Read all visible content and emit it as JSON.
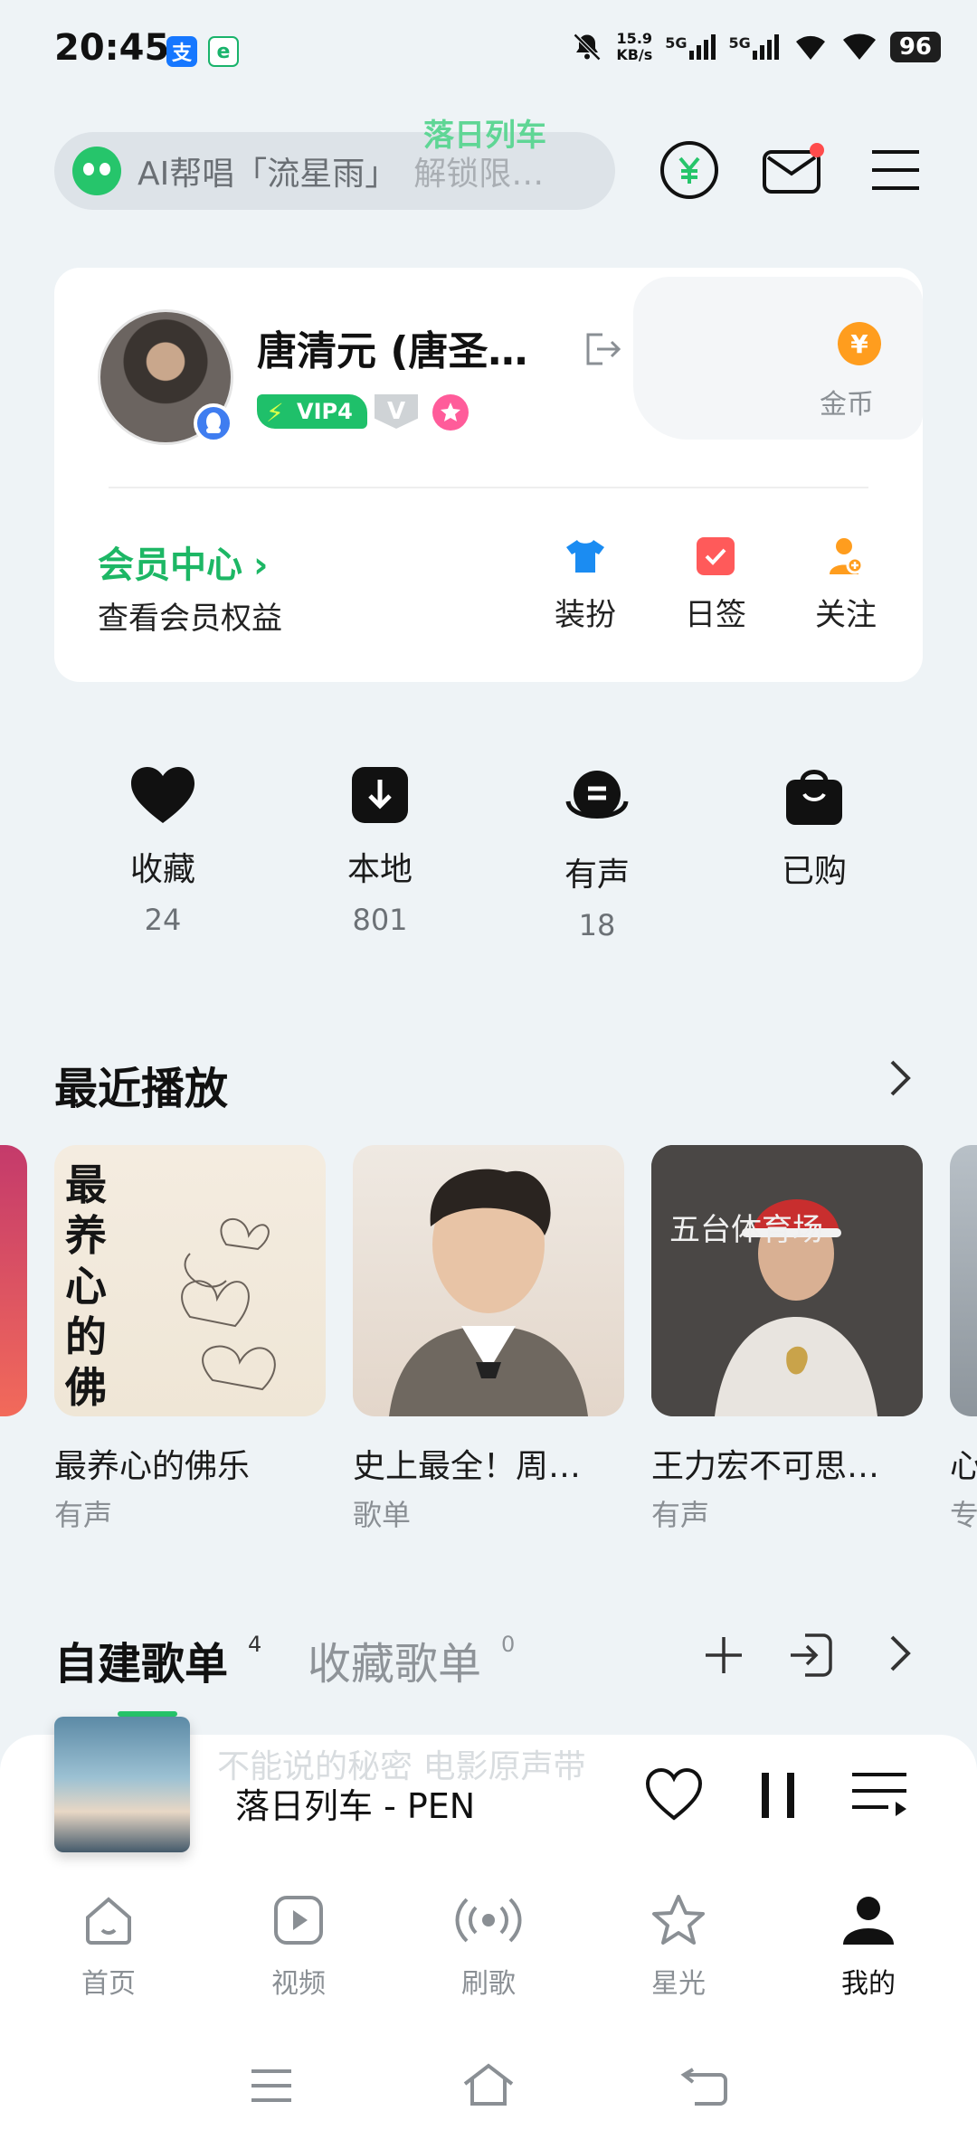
{
  "status_bar": {
    "time": "20:45",
    "app_icon_1": "支",
    "app_icon_2": "e",
    "speed_value": "15.9",
    "speed_unit": "KB/s",
    "net1": "5G",
    "net2": "5G",
    "battery": "96"
  },
  "top": {
    "search_text": "AI帮唱「流星雨」",
    "search_text_dim": "解锁限…",
    "overlay_song": "落日列车"
  },
  "profile": {
    "name": "唐清元 (唐圣…",
    "vip_label": "VIP4",
    "v_badge": "V",
    "coin_symbol": "¥",
    "coin_label": "金币",
    "vip_center": "会员中心",
    "vip_center_sub": "查看会员权益",
    "actions": [
      {
        "label": "装扮",
        "icon": "shirt-icon"
      },
      {
        "label": "日签",
        "icon": "checkin-icon"
      },
      {
        "label": "关注",
        "icon": "add-user-icon"
      }
    ]
  },
  "stats": [
    {
      "label": "收藏",
      "count": "24",
      "icon": "heart-icon"
    },
    {
      "label": "本地",
      "count": "801",
      "icon": "download-icon"
    },
    {
      "label": "有声",
      "count": "18",
      "icon": "audiobook-icon"
    },
    {
      "label": "已购",
      "count": "",
      "icon": "bag-icon"
    }
  ],
  "recent": {
    "title": "最近播放",
    "items": [
      {
        "title": "最养心的佛乐",
        "type": "有声",
        "cover_text": "最养心的佛乐"
      },
      {
        "title": "史上最全！周…",
        "type": "歌单"
      },
      {
        "title": "王力宏不可思…",
        "type": "有声",
        "cover_text": "五台体育场"
      }
    ],
    "partial_item": {
      "title": "心",
      "type": "专"
    }
  },
  "playlists": {
    "tab_created": "自建歌单",
    "tab_created_count": "4",
    "tab_collected": "收藏歌单",
    "tab_collected_count": "0"
  },
  "player": {
    "hint_text": "不能说的秘密 电影原声带",
    "now_playing": "落日列车 - PEN"
  },
  "nav": [
    {
      "label": "首页",
      "icon": "home-icon"
    },
    {
      "label": "视频",
      "icon": "video-icon"
    },
    {
      "label": "刷歌",
      "icon": "radio-icon"
    },
    {
      "label": "星光",
      "icon": "star-icon"
    },
    {
      "label": "我的",
      "icon": "user-icon",
      "active": true
    }
  ],
  "colors": {
    "accent": "#1db765",
    "background": "#eef3f6"
  }
}
